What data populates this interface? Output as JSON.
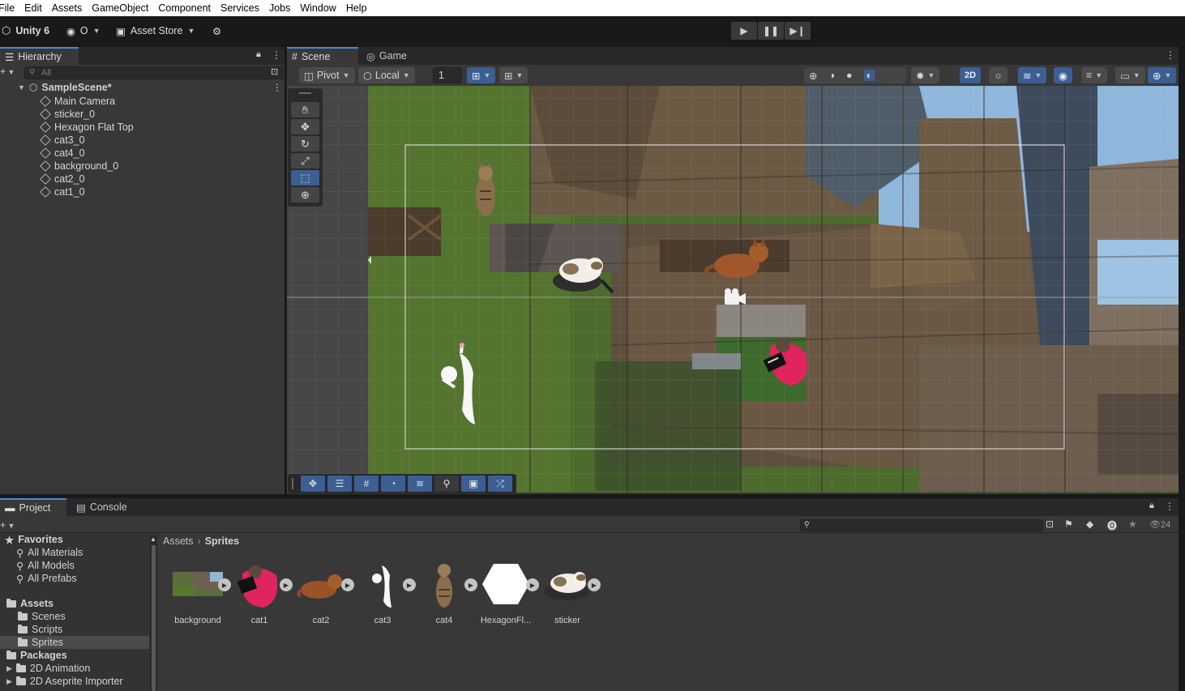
{
  "menu": [
    "File",
    "Edit",
    "Assets",
    "GameObject",
    "Component",
    "Services",
    "Jobs",
    "Window",
    "Help"
  ],
  "toolbar": {
    "unity_label": "Unity 6",
    "account_label": "O",
    "asset_store_label": "Asset Store"
  },
  "hierarchy": {
    "tab_label": "Hierarchy",
    "search_placeholder": "All",
    "scene_name": "SampleScene*",
    "items": [
      "Main Camera",
      "sticker_0",
      "Hexagon Flat Top",
      "cat3_0",
      "cat4_0",
      "background_0",
      "cat2_0",
      "cat1_0"
    ]
  },
  "scene": {
    "tabs": [
      "Scene",
      "Game"
    ],
    "pivot_label": "Pivot",
    "local_label": "Local",
    "grid_value": "1",
    "mode_2d_label": "2D"
  },
  "project": {
    "tabs": [
      "Project",
      "Console"
    ],
    "breadcrumb": [
      "Assets",
      "Sprites"
    ],
    "count": "24",
    "favorites_label": "Favorites",
    "favorites": [
      "All Materials",
      "All Models",
      "All Prefabs"
    ],
    "assets_label": "Assets",
    "asset_folders": [
      "Scenes",
      "Scripts",
      "Sprites"
    ],
    "packages_label": "Packages",
    "packages": [
      "2D Animation",
      "2D Aseprite Importer"
    ],
    "sprites": [
      "background",
      "cat1",
      "cat2",
      "cat3",
      "cat4",
      "HexagonFl...",
      "sticker"
    ]
  },
  "colors": {
    "accent": "#3b5f93",
    "tab_highlight": "#4a8ad4",
    "panel": "#383838",
    "dark": "#191919",
    "grass": "#4d6b2c"
  }
}
